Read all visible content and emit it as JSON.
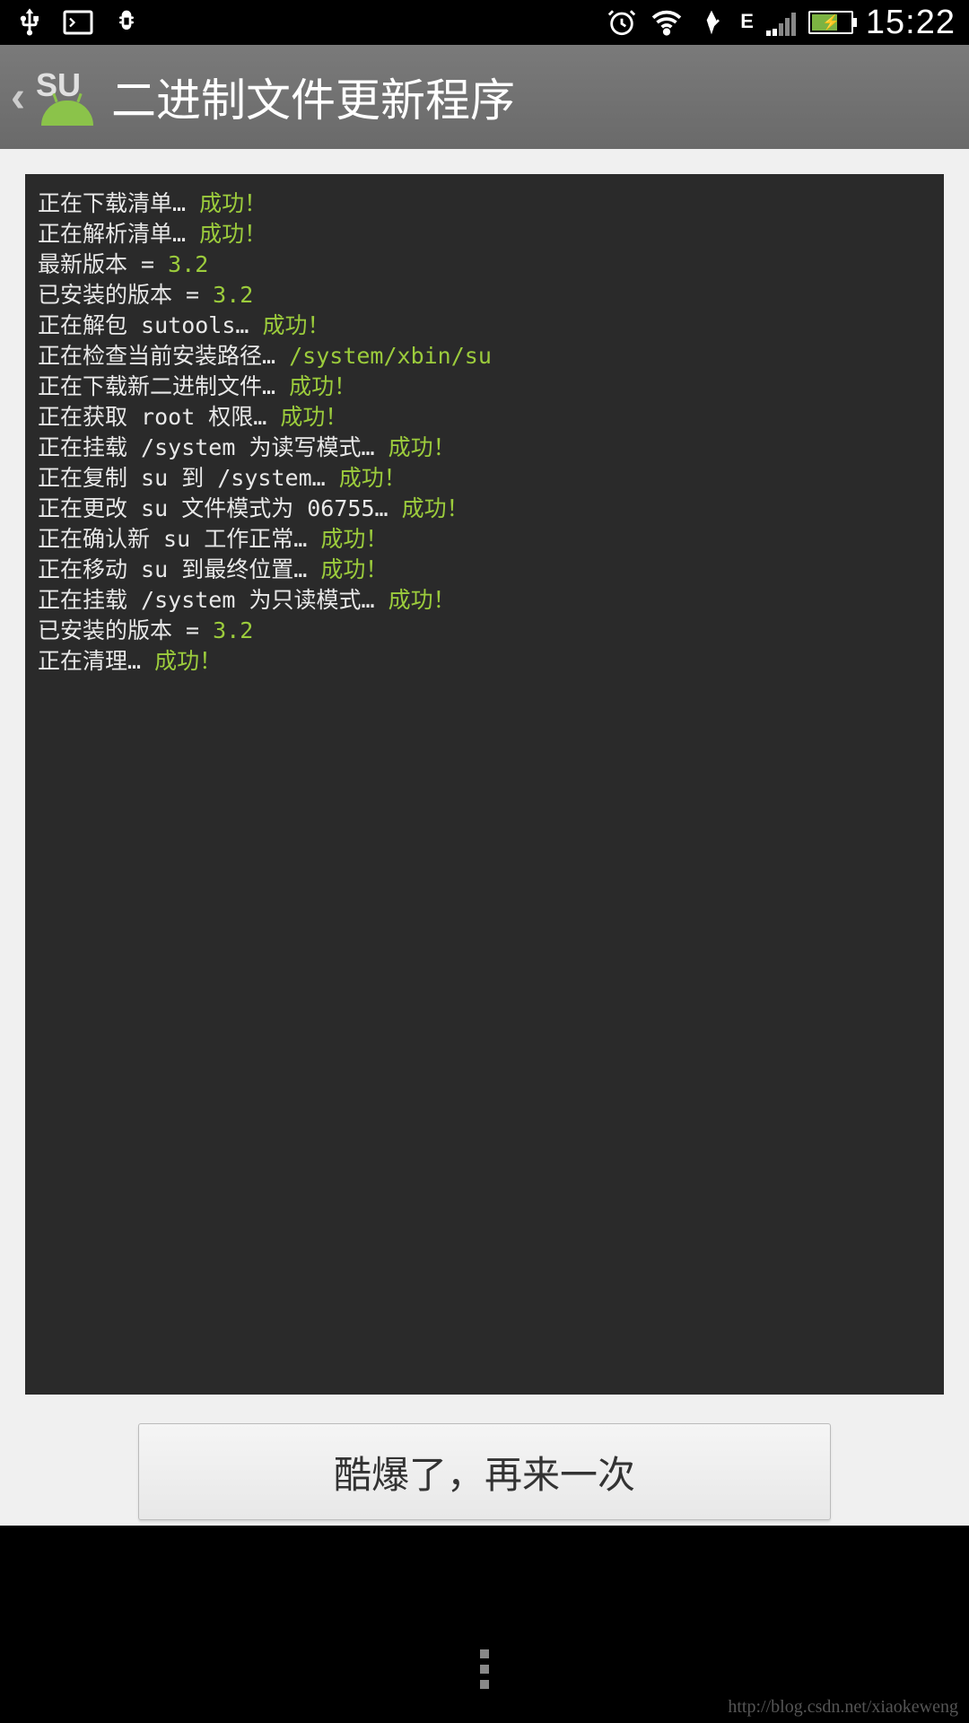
{
  "status_bar": {
    "time": "15:22",
    "network_type": "E"
  },
  "header": {
    "title": "二进制文件更新程序"
  },
  "terminal": {
    "lines": [
      {
        "text": "正在下载清单… ",
        "status": "成功！"
      },
      {
        "text": "正在解析清单… ",
        "status": "成功！"
      },
      {
        "text": "最新版本 = ",
        "value": "3.2"
      },
      {
        "text": "已安装的版本 = ",
        "value": "3.2"
      },
      {
        "text": "正在解包 sutools… ",
        "status": "成功！"
      },
      {
        "text": "正在检查当前安装路径… ",
        "value": "/system/xbin/su"
      },
      {
        "text": "正在下载新二进制文件… ",
        "status": "成功！"
      },
      {
        "text": "正在获取 root 权限… ",
        "status": "成功！"
      },
      {
        "text": "正在挂载 /system 为读写模式… ",
        "status": "成功！"
      },
      {
        "text": "正在复制 su 到 /system… ",
        "status": "成功！"
      },
      {
        "text": "正在更改 su 文件模式为 06755… ",
        "status": "成功！"
      },
      {
        "text": "正在确认新 su 工作正常… ",
        "status": "成功！"
      },
      {
        "text": "正在移动 su 到最终位置… ",
        "status": "成功！"
      },
      {
        "text": "正在挂载 /system 为只读模式… ",
        "status": "成功！"
      },
      {
        "text": "已安装的版本 = ",
        "value": "3.2"
      },
      {
        "text": "正在清理… ",
        "status": "成功！"
      }
    ]
  },
  "button": {
    "label": "酷爆了，再来一次"
  },
  "watermark": "http://blog.csdn.net/xiaokeweng"
}
